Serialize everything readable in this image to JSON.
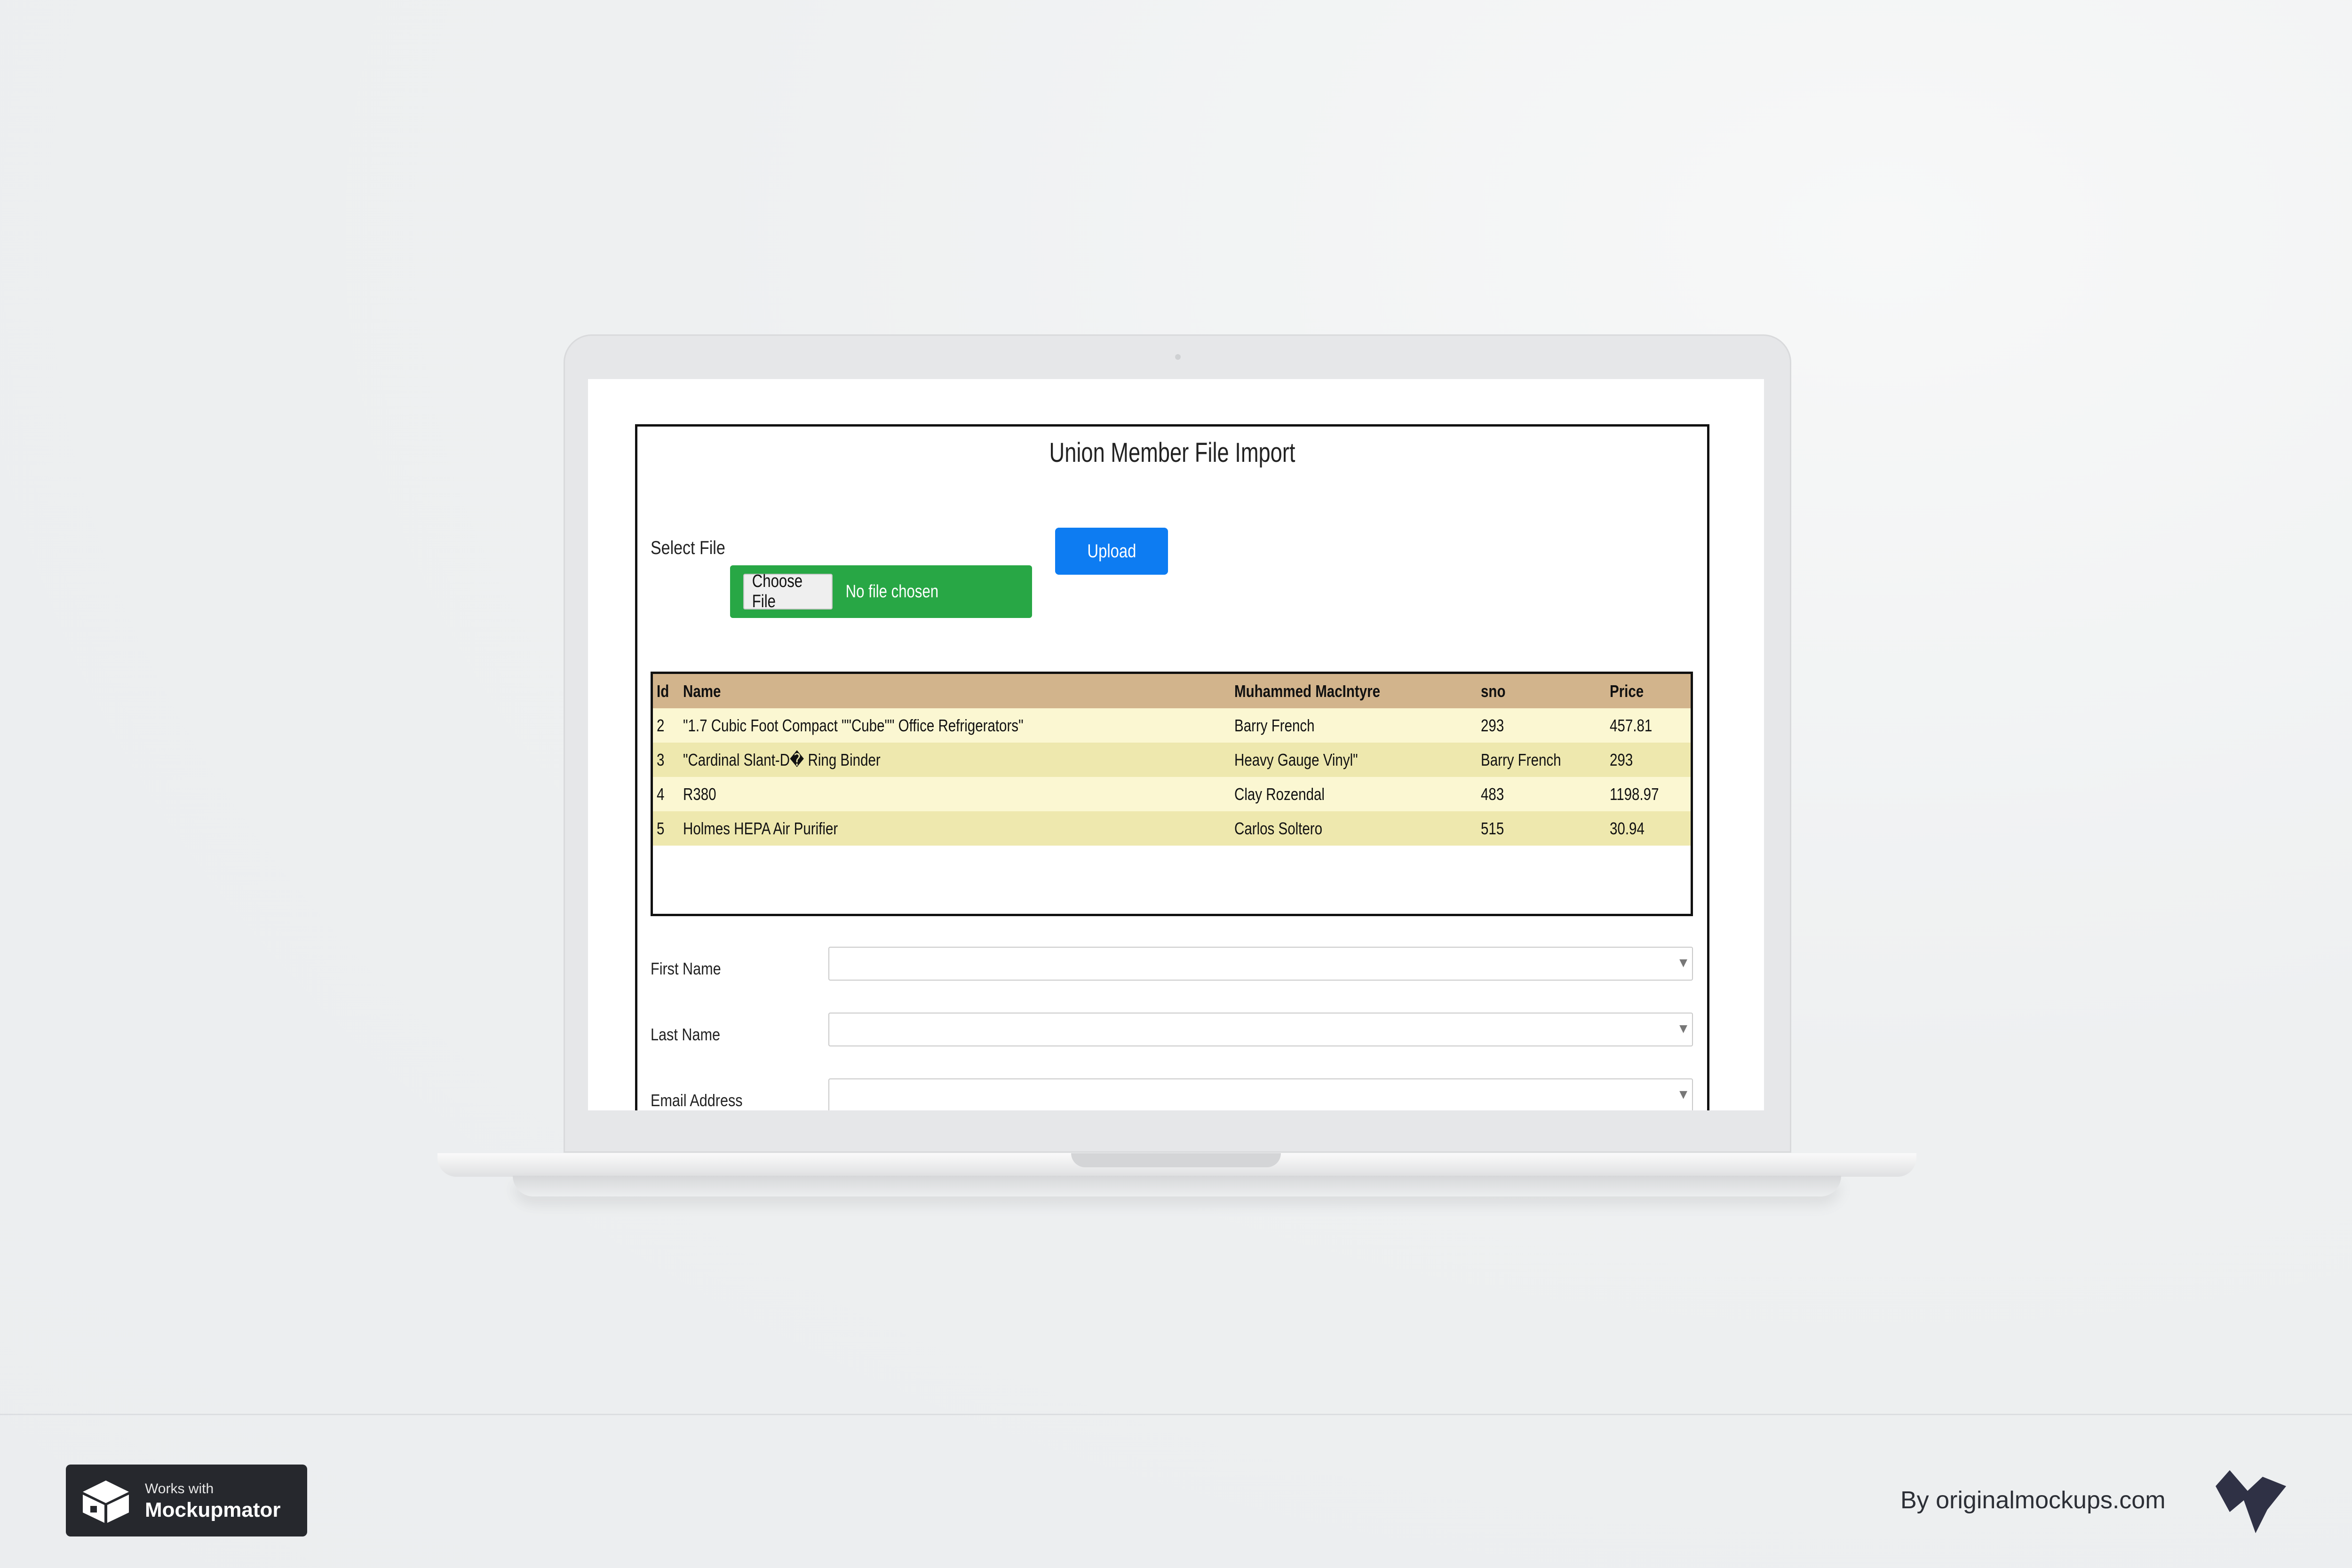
{
  "app": {
    "title": "Union Member File Import",
    "select_file_label": "Select File",
    "choose_file_label": "Choose File",
    "no_file_text": "No file chosen",
    "upload_label": "Upload"
  },
  "table": {
    "headers": [
      "Id",
      "Name",
      "Muhammed MacIntyre",
      "sno",
      "Price"
    ],
    "rows": [
      [
        "2",
        "\"1.7 Cubic Foot Compact \"\"Cube\"\" Office Refrigerators\"",
        "Barry French",
        "293",
        "457.81"
      ],
      [
        "3",
        "\"Cardinal Slant-D� Ring Binder",
        "Heavy Gauge Vinyl\"",
        "Barry French",
        "293"
      ],
      [
        "4",
        "R380",
        "Clay Rozendal",
        "483",
        "1198.97"
      ],
      [
        "5",
        "Holmes HEPA Air Purifier",
        "Carlos Soltero",
        "515",
        "30.94"
      ]
    ]
  },
  "form": {
    "first_name_label": "First Name",
    "last_name_label": "Last Name",
    "email_label": "Email Address"
  },
  "badge": {
    "small_text": "Works with",
    "big_text": "Mockupmator"
  },
  "credit": "By originalmockups.com",
  "colors": {
    "upload_button": "#0d7cf2",
    "file_box": "#28a745",
    "table_header": "#d2b48c",
    "row_odd": "#fbf7d2",
    "row_even": "#eee8ae"
  }
}
